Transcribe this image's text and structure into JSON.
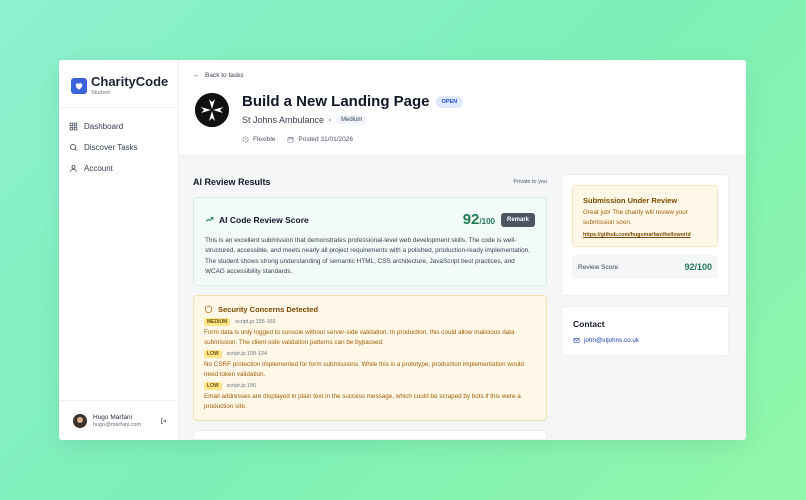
{
  "brand": {
    "name": "CharityCode",
    "role": "Student",
    "accent": "#3b63d9"
  },
  "nav": [
    {
      "label": "Dashboard",
      "icon": "grid-icon"
    },
    {
      "label": "Discover Tasks",
      "icon": "search-icon"
    },
    {
      "label": "Account",
      "icon": "user-icon"
    }
  ],
  "user": {
    "name": "Hugo Marfani",
    "email": "hugo@marfani.com"
  },
  "header": {
    "back_label": "Back to tasks",
    "title": "Build a New Landing Page",
    "status": "OPEN",
    "org": "St Johns Ambulance",
    "difficulty": "Medium",
    "schedule": "Flexible",
    "posted": "Posted 31/01/2026"
  },
  "review": {
    "section_title": "AI Review Results",
    "privacy": "Private to you",
    "score_label": "AI Code Review Score",
    "score": "92",
    "score_out_of": "/100",
    "remark_label": "Remark",
    "summary": "This is an excellent submission that demonstrates professional-level web development skills. The code is well-structured, accessible, and meets nearly all project requirements with a polished, production-ready implementation. The student shows strong understanding of semantic HTML, CSS architecture, JavaScript best practices, and WCAG accessibility standards."
  },
  "security": {
    "title": "Security Concerns Detected",
    "issues": [
      {
        "severity": "MEDIUM",
        "location": "script.js:155-165",
        "text": "Form data is only logged to console without server-side validation. In production, this could allow malicious data submission. The client-side validation patterns can be bypassed."
      },
      {
        "severity": "LOW",
        "location": "script.js:109-124",
        "text": "No CSRF protection implemented for form submissions. While this is a prototype, production implementation would need token validation."
      },
      {
        "severity": "LOW",
        "location": "script.js:196",
        "text": "Email addresses are displayed in plain text in the success message, which could be scraped by bots if this were a production site."
      }
    ]
  },
  "submission": {
    "title": "Submission Under Review",
    "text": "Great job! The charity will review your submission soon.",
    "link": "https://github.com/hugomarfani/helloworld",
    "score_label": "Review Score",
    "score_value": "92/100"
  },
  "contact": {
    "title": "Contact",
    "email": "john@stjohns.co.uk"
  }
}
